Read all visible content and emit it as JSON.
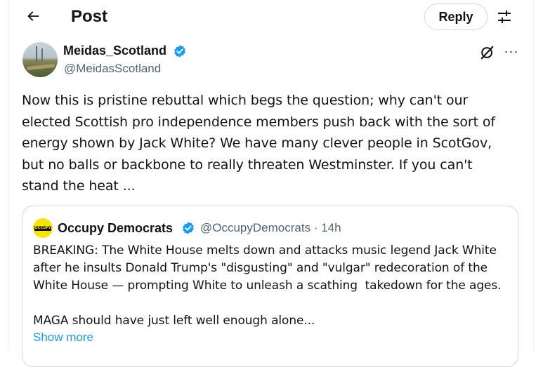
{
  "header": {
    "title": "Post",
    "reply_label": "Reply"
  },
  "post": {
    "author_name": "Meidas_Scotland",
    "author_handle": "@MeidasScotland",
    "text": "Now this is pristine rebuttal which begs the question; why can't our\nelected Scottish pro independence members push back with the sort of\nenergy shown by Jack White? We have many clever people in ScotGov,\nbut no balls or backbone to really threaten Westminster. If you can't\nstand the heat ...",
    "more_label": "···"
  },
  "quote": {
    "author_name": "Occupy Democrats",
    "author_handle": "@OccupyDemocrats",
    "separator": "·",
    "time": "14h",
    "avatar_text": "OCCUPY",
    "text": "BREAKING: The White House melts down and attacks music legend Jack White\nafter he insults Donald Trump's \"disgusting\" and \"vulgar\" redecoration of the\nWhite House — prompting White to unleash a scathing  takedown for the ages.\n\nMAGA should have just left well enough alone...",
    "show_more_label": "Show more"
  },
  "icons": {
    "back": "arrow-left-icon",
    "filter": "sliders-icon",
    "verified": "verified-badge-icon",
    "grok": "grok-icon",
    "more": "more-icon"
  },
  "colors": {
    "accent": "#1d9bf0",
    "text": "#0f1419",
    "secondary": "#536471",
    "border": "#cfd9de"
  }
}
